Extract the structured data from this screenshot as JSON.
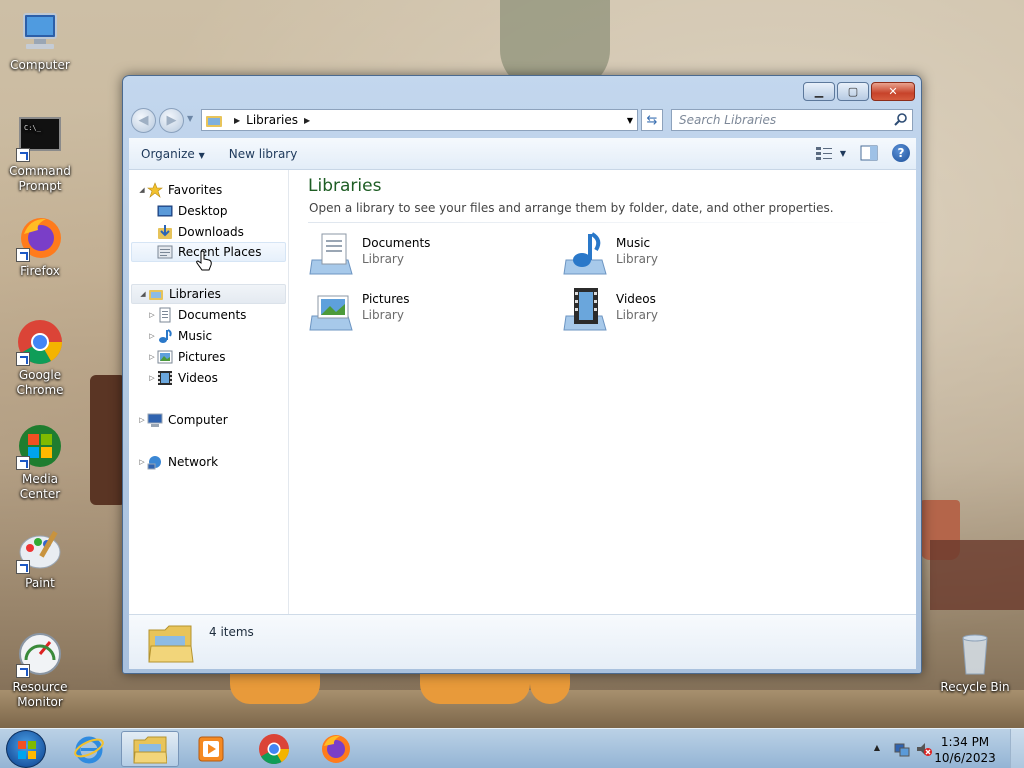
{
  "desktop": {
    "icons": [
      {
        "label": "Computer"
      },
      {
        "label": "Command Prompt"
      },
      {
        "label": "Firefox"
      },
      {
        "label": "Google Chrome"
      },
      {
        "label": "Media Center"
      },
      {
        "label": "Paint"
      },
      {
        "label": "Resource Monitor"
      },
      {
        "label": "Recycle Bin"
      }
    ]
  },
  "window": {
    "address": {
      "crumb": "Libraries"
    },
    "search": {
      "placeholder": "Search Libraries"
    },
    "toolbar": {
      "organize": "Organize",
      "new_library": "New library"
    },
    "nav": {
      "favorites": "Favorites",
      "desktop": "Desktop",
      "downloads": "Downloads",
      "recent_places": "Recent Places",
      "libraries": "Libraries",
      "documents": "Documents",
      "music": "Music",
      "pictures": "Pictures",
      "videos": "Videos",
      "computer": "Computer",
      "network": "Network"
    },
    "main": {
      "title": "Libraries",
      "subtitle": "Open a library to see your files and arrange them by folder, date, and other properties.",
      "items": [
        {
          "name": "Documents",
          "type": "Library"
        },
        {
          "name": "Music",
          "type": "Library"
        },
        {
          "name": "Pictures",
          "type": "Library"
        },
        {
          "name": "Videos",
          "type": "Library"
        }
      ]
    },
    "details": {
      "count": "4 items"
    }
  },
  "taskbar": {
    "clock": {
      "time": "1:34 PM",
      "date": "10/6/2023"
    }
  },
  "colors": {
    "title_green": "#1e5d24",
    "window_frame": "#b5cbe4",
    "close_red": "#c7432a"
  }
}
